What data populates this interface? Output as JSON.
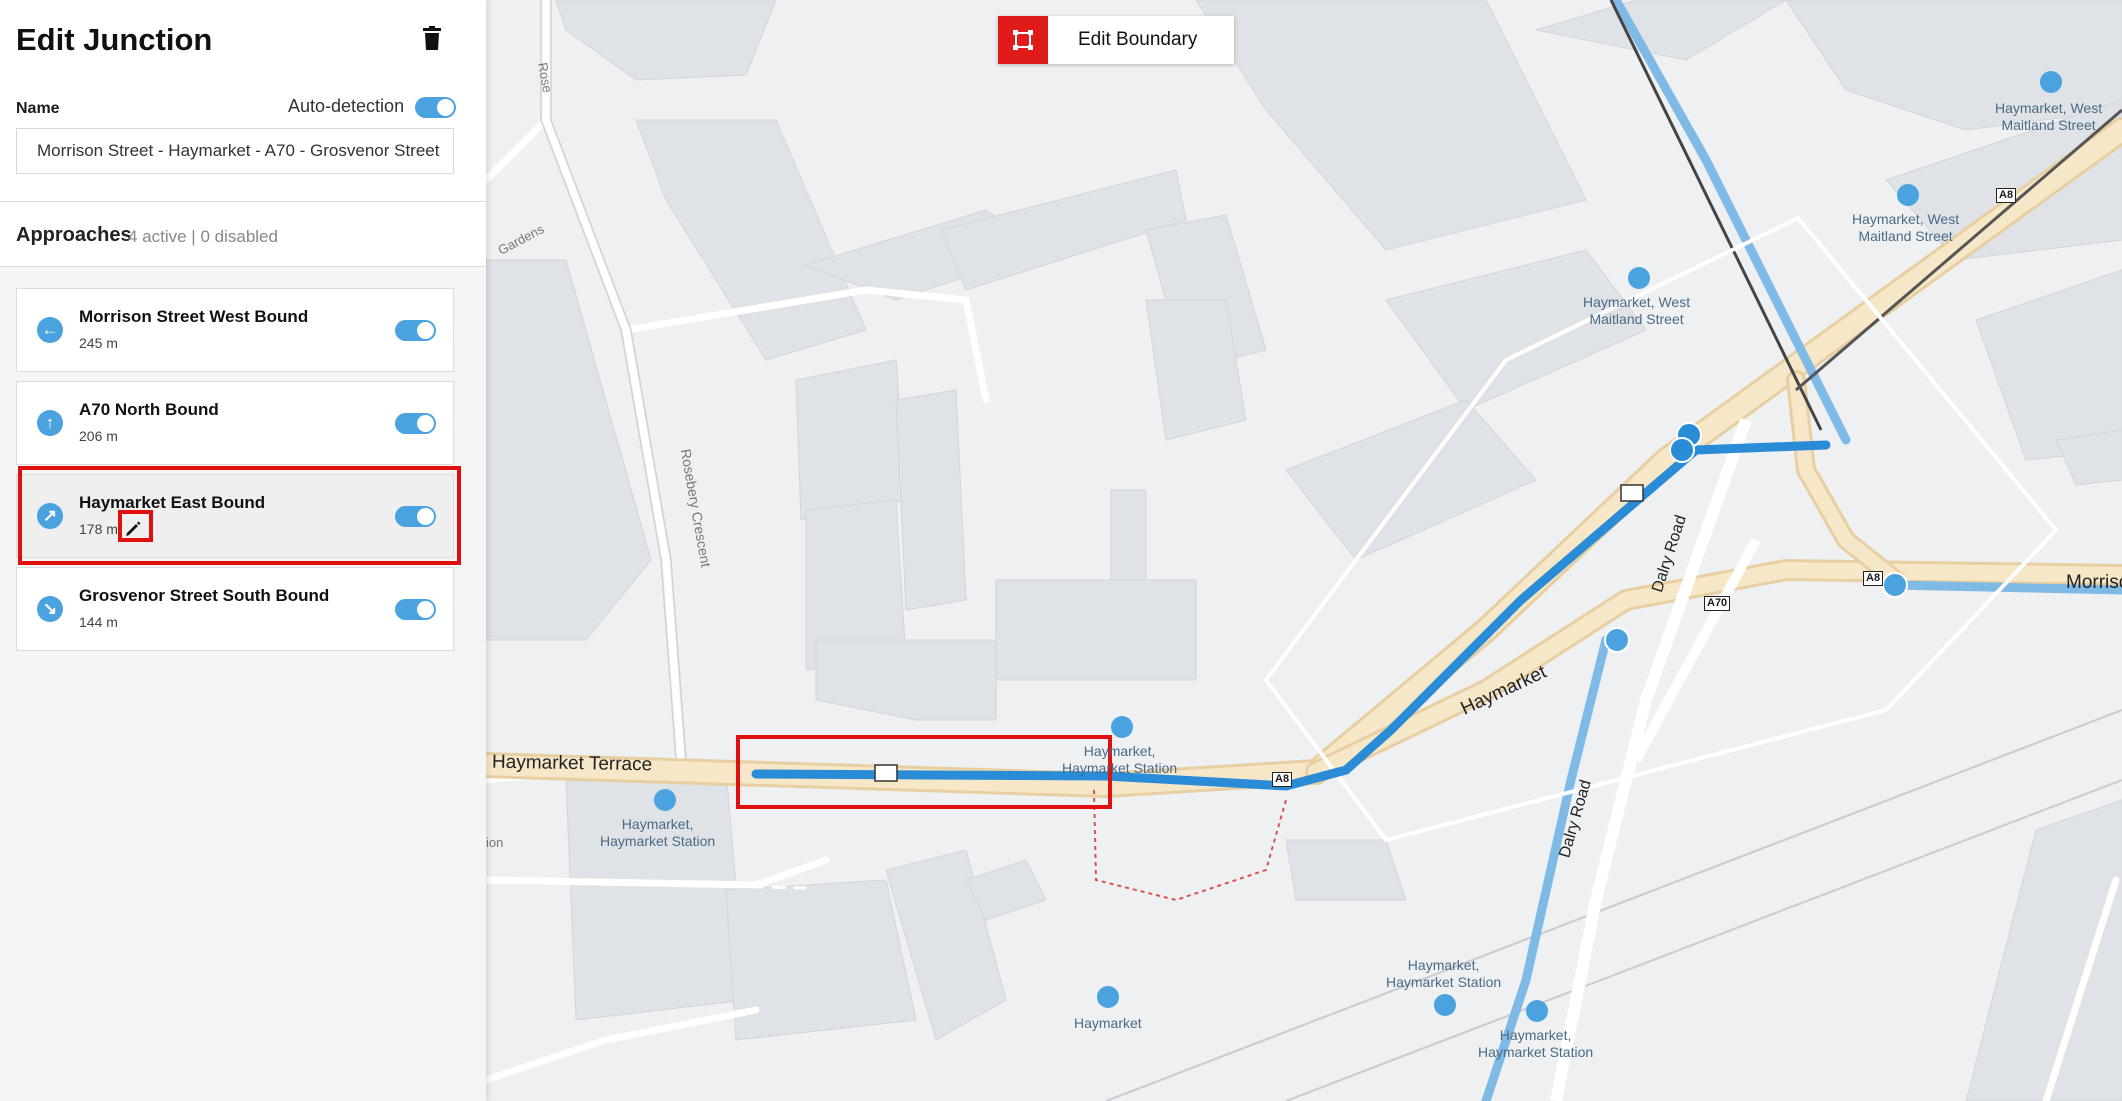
{
  "panel": {
    "title": "Edit Junction",
    "name_label": "Name",
    "auto_detection_label": "Auto-detection",
    "name_value": "Morrison Street - Haymarket - A70 - Grosvenor Street",
    "approaches_title": "Approaches",
    "approaches_meta": "4 active | 0 disabled"
  },
  "approaches": [
    {
      "name": "Morrison Street West Bound",
      "length": "245 m",
      "direction": "west"
    },
    {
      "name": "A70 North Bound",
      "length": "206 m",
      "direction": "north"
    },
    {
      "name": "Haymarket East Bound",
      "length": "178 m",
      "direction": "east"
    },
    {
      "name": "Grosvenor Street South Bound",
      "length": "144 m",
      "direction": "south"
    }
  ],
  "toolbar": {
    "edit_boundary_label": "Edit Boundary"
  },
  "map": {
    "road_labels": {
      "haymarket_terrace": "Haymarket Terrace",
      "haymarket": "Haymarket",
      "dalry_road": "Dalry Road",
      "dalry_road_2": "Dalry Road",
      "morrison": "Morrison",
      "rosebery": "Rosebery Crescent",
      "gardens": "Gardens",
      "roseb_top": "Rose",
      "ion": "ion"
    },
    "shields": {
      "a8_top": "A8",
      "a8_right": "A8",
      "a70": "A70",
      "a8_small": "A8"
    },
    "stops": {
      "hs_left_1": "Haymarket,",
      "hs_left_2": "Haymarket Station",
      "hs_center_1": "Haymarket,",
      "hs_center_2": "Haymarket Station",
      "hw_mid_1": "Haymarket, West",
      "hw_mid_2": "Maitland Street",
      "hw_right_1": "Haymarket, West",
      "hw_right_2": "Maitland Street",
      "hw_top_1": "Haymarket, West",
      "hw_top_2": "Maitland Street",
      "hs_bottom_1": "Haymarket,",
      "hs_bottom_2": "Haymarket Station",
      "hs_bottom_right_1": "Haymarket,",
      "hs_bottom_right_2": "Haymarket Station",
      "haymarket_bottom": "Haymarket"
    }
  },
  "colors": {
    "accent": "#4aa3df",
    "route": "#2a8bd6",
    "highlight": "#e01010",
    "road_fill": "#f7e7c9"
  }
}
